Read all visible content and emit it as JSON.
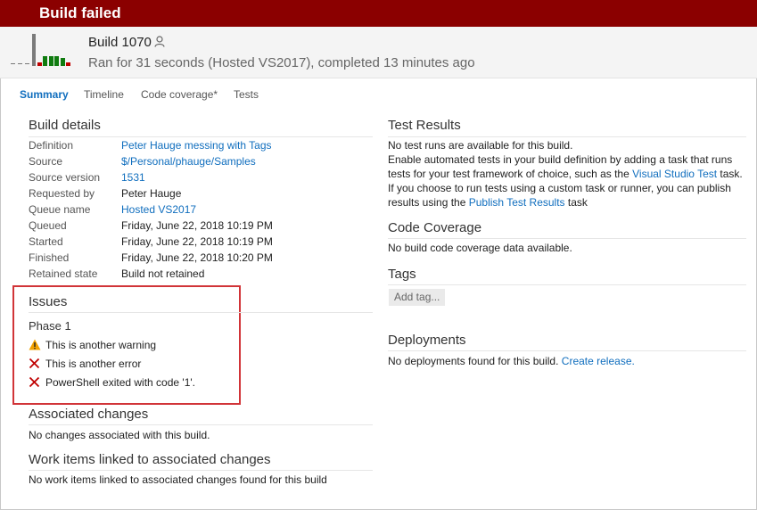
{
  "banner": {
    "title": "Build failed",
    "color": "#8b0000"
  },
  "build": {
    "number": "Build 1070",
    "ran_for": "Ran for 31 seconds (Hosted VS2017), completed 13 minutes ago",
    "history": [
      {
        "status": "none"
      },
      {
        "status": "none"
      },
      {
        "status": "none"
      },
      {
        "status": "current-failed",
        "level": 1.0
      },
      {
        "status": "failed",
        "level": 0.1
      },
      {
        "status": "succeeded",
        "level": 0.3
      },
      {
        "status": "succeeded",
        "level": 0.3
      },
      {
        "status": "succeeded",
        "level": 0.3
      },
      {
        "status": "succeeded",
        "level": 0.25
      },
      {
        "status": "failed",
        "level": 0.1
      }
    ]
  },
  "tabs": [
    "Summary",
    "Timeline",
    "Code coverage*",
    "Tests"
  ],
  "build_details": {
    "heading": "Build details",
    "rows": [
      {
        "label": "Definition",
        "value": "Peter Hauge messing with Tags",
        "link": true
      },
      {
        "label": "Source",
        "value": "$/Personal/phauge/Samples",
        "link": true
      },
      {
        "label": "Source version",
        "value": "1531",
        "link": true
      },
      {
        "label": "Requested by",
        "value": "Peter Hauge",
        "link": false
      },
      {
        "label": "Queue name",
        "value": "Hosted VS2017",
        "link": true
      },
      {
        "label": "Queued",
        "value": "Friday, June 22, 2018 10:19 PM",
        "link": false
      },
      {
        "label": "Started",
        "value": "Friday, June 22, 2018 10:19 PM",
        "link": false
      },
      {
        "label": "Finished",
        "value": "Friday, June 22, 2018 10:20 PM",
        "link": false
      },
      {
        "label": "Retained state",
        "value": "Build not retained",
        "link": false
      }
    ]
  },
  "issues": {
    "heading": "Issues",
    "phase": "Phase 1",
    "items": [
      {
        "type": "warning",
        "text": "This is another warning"
      },
      {
        "type": "error",
        "text": "This is another error"
      },
      {
        "type": "error",
        "text": "PowerShell exited with code '1'."
      }
    ]
  },
  "associated_changes": {
    "heading": "Associated changes",
    "text": "No changes associated with this build."
  },
  "work_items": {
    "heading": "Work items linked to associated changes",
    "text": "No work items linked to associated changes found for this build"
  },
  "test_results": {
    "heading": "Test Results",
    "line1": "No test runs are available for this build.",
    "line2": "Enable automated tests in your build definition by adding a task that runs",
    "line3_pre": "tests for your test framework of choice, such as the ",
    "line3_link": "Visual Studio Test",
    "line3_post": " task.",
    "line4": "If you choose to run tests using a custom task or runner, you can publish",
    "line5_pre": "results using the ",
    "line5_link": "Publish Test Results",
    "line5_post": " task"
  },
  "code_coverage": {
    "heading": "Code Coverage",
    "text": "No build code coverage data available."
  },
  "tags": {
    "heading": "Tags",
    "add_label": "Add tag..."
  },
  "deployments": {
    "heading": "Deployments",
    "text": "No deployments found for this build. ",
    "link": "Create release."
  },
  "colors": {
    "link": "#106ebe",
    "failed": "#c00000",
    "succeeded": "#107c10",
    "warning": "#f2a100",
    "issues_border": "#d13438"
  }
}
